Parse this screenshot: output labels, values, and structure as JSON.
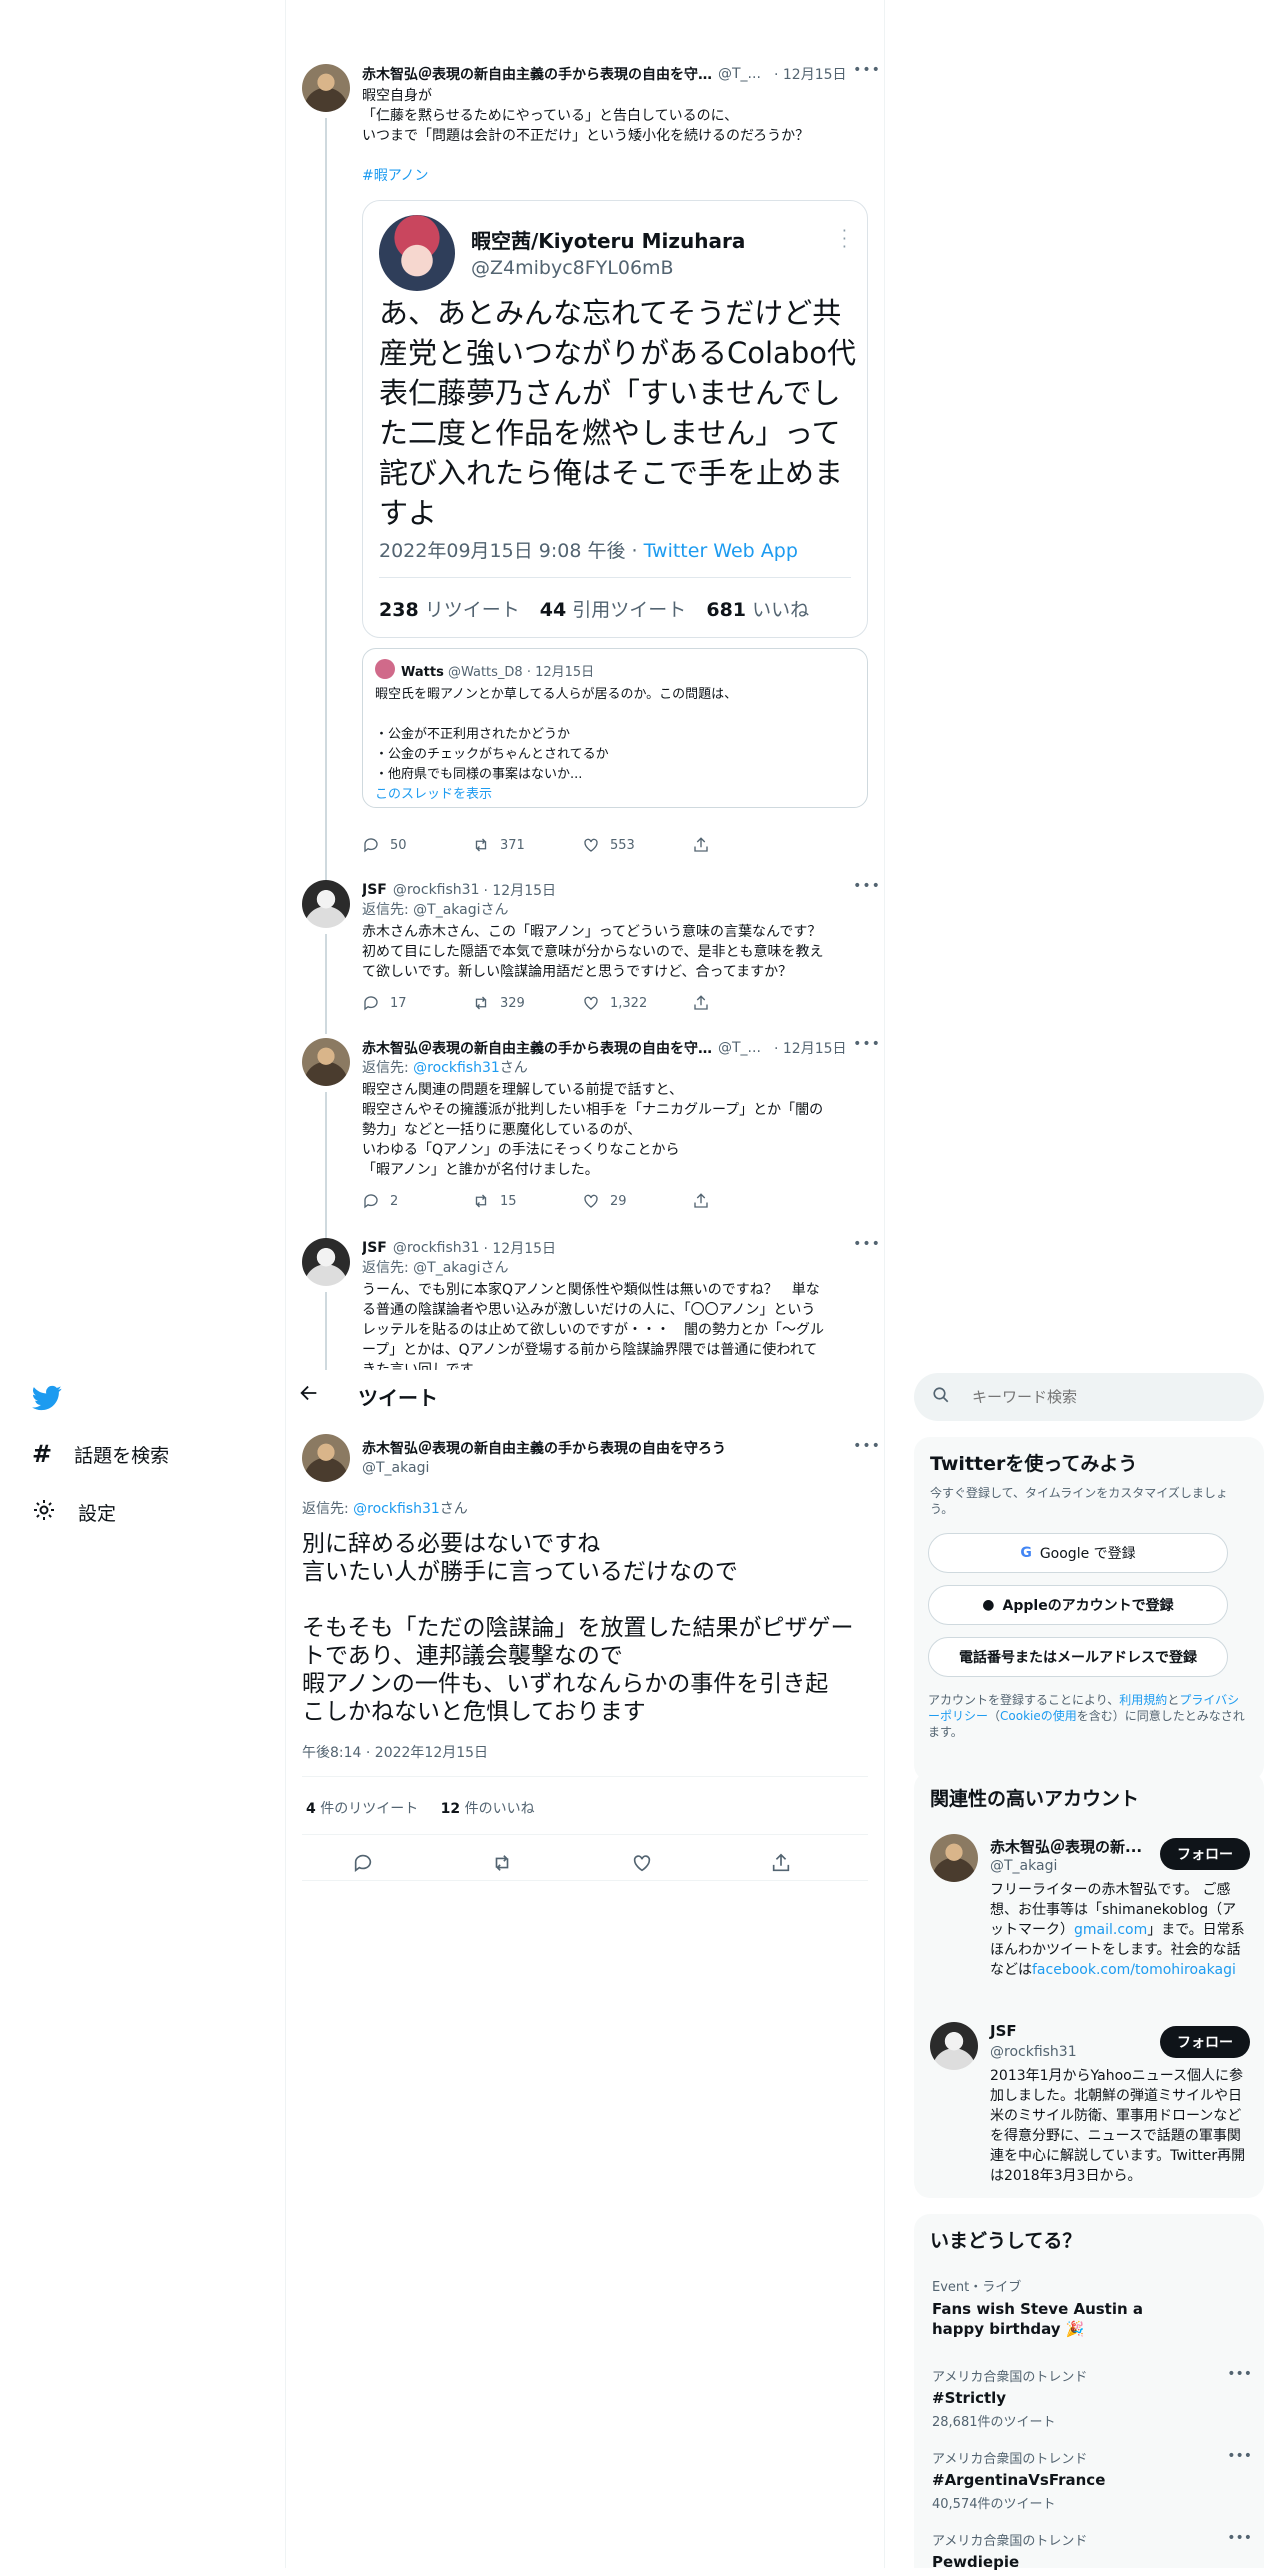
{
  "nav": {
    "search_label": "話題を検索",
    "settings_label": "設定"
  },
  "header": {
    "title": "ツイート"
  },
  "thread": [
    {
      "name": "赤木智弘＠表現の新自由主義の手から表現の自由を守ろう",
      "handle": "@T_...",
      "time": "· 12月15日",
      "text": "暇空自身が\n「仁藤を黙らせるためにやっている」と告白しているのに、\nいつまで「問題は会計の不正だけ」という矮小化を続けるのだろうか？",
      "hashtag": "#暇アノン",
      "embed_tweet": {
        "name": "暇空茜/Kiyoteru Mizuhara",
        "handle": "@Z4mibyc8FYL06mB",
        "text": "あ、あとみんな忘れてそうだけど共産党と強いつながりがあるColabo代表仁藤夢乃さんが「すいませんでした二度と作品を燃やしません」って詫び入れたら俺はそこで手を止めますよ",
        "date": "2022年09月15日 9:08 午後",
        "sep": " · ",
        "via": "Twitter Web App",
        "rt_count": "238",
        "rt_label": "リツイート",
        "qt_count": "44",
        "qt_label": "引用ツイート",
        "like_count": "681",
        "like_label": "いいね"
      },
      "quote": {
        "name": "Watts",
        "handle": "@Watts_D8 · 12月15日",
        "text": "暇空氏を暇アノンとか草してる人らが居るのか。この問題は、\n\n・公金が不正利用されたかどうか\n・公金のチェックがちゃんとされてるか\n・他府県でも同様の事案はないか...",
        "show_thread": "このスレッドを表示"
      },
      "replies": "50",
      "retweets": "371",
      "likes": "553"
    },
    {
      "name": "JSF",
      "handle": "@rockfish31",
      "time": "· 12月15日",
      "reply_to_label": "返信先: ",
      "reply_to": "@T_akagiさん",
      "text": "赤木さん赤木さん、この「暇アノン」ってどういう意味の言葉なんです？\n初めて目にした隠語で本気で意味が分からないので、是非とも意味を教え\nて欲しいです。新しい陰謀論用語だと思うですけど、合ってますか？",
      "replies": "17",
      "retweets": "329",
      "likes": "1,322"
    },
    {
      "name": "赤木智弘＠表現の新自由主義の手から表現の自由を守ろう",
      "handle": "@T_...",
      "time": "· 12月15日",
      "reply_to_label": "返信先: ",
      "reply_to": "@rockfish31",
      "reply_suffix": "さん",
      "text": "暇空さん関連の問題を理解している前提で話すと、\n暇空さんやその擁護派が批判したい相手を「ナニカグループ」とか「闇の\n勢力」などと一括りに悪魔化しているのが、\nいわゆる「Qアノン」の手法にそっくりなことから\n「暇アノン」と誰かが名付けました。",
      "replies": "2",
      "retweets": "15",
      "likes": "29"
    },
    {
      "name": "JSF",
      "handle": "@rockfish31",
      "time": "· 12月15日",
      "reply_to_label": "返信先: ",
      "reply_to": "@T_akagiさん",
      "text": "うーん、でも別に本家Qアノンと関係性や類似性は無いのですね？　単な\nる普通の陰謀論者や思い込みが激しいだけの人に、「〇〇アノン」という\nレッテルを貼るのは止めて欲しいのですが・・・　闇の勢力とか「～グル\nープ」とかは、Qアノンが登場する前から陰謀論界隈では普通に使われて\nきた言い回しです。"
    }
  ],
  "main": {
    "name": "赤木智弘＠表現の新自由主義の手から表現の自由を守ろう",
    "handle": "@T_akagi",
    "reply_to_label": "返信先: ",
    "reply_to": "@rockfish31",
    "reply_suffix": "さん",
    "text": "別に辞める必要はないですね\n言いたい人が勝手に言っているだけなので\n\nそもそも「ただの陰謀論」を放置した結果がピザゲー\nトであり、連邦議会襲撃なので\n暇アノンの一件も、いずれなんらかの事件を引き起\nこしかねないと危惧しております",
    "time": "午後8:14 · 2022年12月15日",
    "rt_count": "4",
    "rt_label": " 件のリツイート",
    "like_count": "12",
    "like_label": " 件のいいね"
  },
  "sidebar": {
    "search_placeholder": "キーワード検索",
    "signup": {
      "title": "Twitterを使ってみよう",
      "subtitle": "今すぐ登録して、タイムラインをカスタマイズしましょう。",
      "google": "Google で登録",
      "apple": "Appleのアカウントで登録",
      "phone": "電話番号またはメールアドレスで登録",
      "legal_1": "アカウントを登録することにより、",
      "legal_terms": "利用規約",
      "legal_2": "と",
      "legal_privacy": "プライバシーポリシー",
      "legal_3": "（",
      "legal_cookie": "Cookieの使用",
      "legal_4": "を含む）に同意したとみなされます。"
    },
    "related": {
      "title": "関連性の高いアカウント",
      "follow_label": "フォロー",
      "accounts": [
        {
          "name": "赤木智弘＠表現の新...",
          "handle": "@T_akagi",
          "bio_1": "フリーライターの赤木智弘です。 ご感想、お仕事等は「shimanekoblog（アットマーク）",
          "bio_link": "gmail.com",
          "bio_2": "」まで。日常系ほんわかツイートをします。社会的な話などは",
          "bio_link2": "facebook.com/tomohiroakagi"
        },
        {
          "name": "JSF",
          "handle": "@rockfish31",
          "bio": "2013年1月からYahooニュース個人に参加しました。北朝鮮の弾道ミサイルや日米のミサイル防衛、軍事用ドローンなどを得意分野に、ニュースで話題の軍事関連を中心に解説しています。Twitter再開は2018年3月3日から。"
        }
      ]
    },
    "trends": {
      "title": "いまどうしてる？",
      "items": [
        {
          "sub": "Event・ライブ",
          "name": "Fans wish Steve Austin a happy birthday 🎉",
          "count": ""
        },
        {
          "sub": "アメリカ合衆国のトレンド",
          "name": "#Strictly",
          "count": "28,681件のツイート"
        },
        {
          "sub": "アメリカ合衆国のトレンド",
          "name": "#ArgentinaVsFrance",
          "count": "40,574件のツイート"
        },
        {
          "sub": "アメリカ合衆国のトレンド",
          "name": "Pewdiepie",
          "count": ""
        }
      ]
    }
  }
}
